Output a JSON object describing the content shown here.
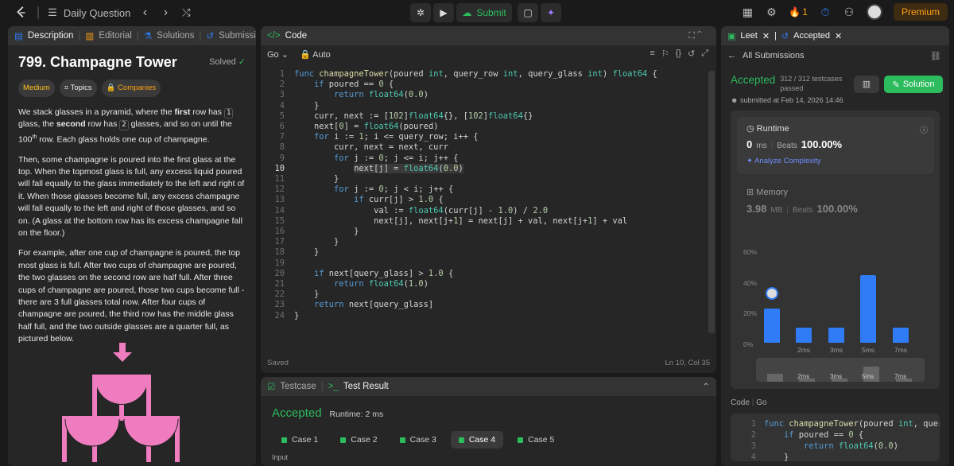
{
  "topbar": {
    "list_label": "Daily Question",
    "submit_label": "Submit",
    "streak": "1",
    "premium_label": "Premium"
  },
  "description": {
    "tabs": [
      "Description",
      "Editorial",
      "Solutions",
      "Submissions"
    ],
    "title": "799. Champagne Tower",
    "status": "Solved",
    "chips": [
      "Medium",
      "Topics",
      "Companies"
    ],
    "p1_a": "We stack glasses in a pyramid, where the ",
    "p1_first": "first",
    "p1_b": " row has ",
    "p1_k1": "1",
    "p1_c": " glass, the ",
    "p1_second": "second",
    "p1_d": " row has ",
    "p1_k2": "2",
    "p1_e": " glasses, and so on until the 100",
    "p1_th": "th",
    "p1_f": " row.  Each glass holds one cup of champagne.",
    "p2": "Then, some champagne is poured into the first glass at the top.  When the topmost glass is full, any excess liquid poured will fall equally to the glass immediately to the left and right of it.  When those glasses become full, any excess champagne will fall equally to the left and right of those glasses, and so on.  (A glass at the bottom row has its excess champagne fall on the floor.)",
    "p3": "For example, after one cup of champagne is poured, the top most glass is full.  After two cups of champagne are poured, the two glasses on the second row are half full.  After three cups of champagne are poured, those two cups become full - there are 3 full glasses total now.  After four cups of champagne are poured, the third row has the middle glass half full, and the two outside glasses are a quarter full, as pictured below."
  },
  "code": {
    "tab": "Code",
    "language": "Go",
    "mode": "Auto",
    "status_left": "Saved",
    "status_right": "Ln 10, Col 35",
    "lines": [
      "func champagneTower(poured int, query_row int, query_glass int) float64 {",
      "    if poured == 0 {",
      "        return float64(0.0)",
      "    }",
      "    curr, next := [102]float64{}, [102]float64{}",
      "    next[0] = float64(poured)",
      "    for i := 1; i <= query_row; i++ {",
      "        curr, next = next, curr",
      "        for j := 0; j <= i; j++ {",
      "            next[j] = float64(0.0)",
      "        }",
      "        for j := 0; j < i; j++ {",
      "            if curr[j] > 1.0 {",
      "                val := float64(curr[j] - 1.0) / 2.0",
      "                next[j], next[j+1] = next[j] + val, next[j+1] + val",
      "            }",
      "        }",
      "    }",
      "",
      "    if next[query_glass] > 1.0 {",
      "        return float64(1.0)",
      "    }",
      "    return next[query_glass]",
      "}"
    ]
  },
  "test": {
    "tabs": [
      "Testcase",
      "Test Result"
    ],
    "result": "Accepted",
    "runtime": "Runtime: 2 ms",
    "cases": [
      "Case 1",
      "Case 2",
      "Case 3",
      "Case 4",
      "Case 5"
    ],
    "active_case": 3,
    "input_label": "Input"
  },
  "submission": {
    "tabs": [
      "Leet",
      "Accepted"
    ],
    "all_label": "All Submissions",
    "status": "Accepted",
    "testcases": "312 / 312 testcases passed",
    "solution_label": "Solution",
    "submitted": "submitted at Feb 14, 2026 14:46",
    "runtime_title": "Runtime",
    "runtime_value": "0",
    "runtime_unit": "ms",
    "beats_label": "Beats",
    "runtime_beats": "100.00%",
    "analyze": "Analyze Complexity",
    "memory_title": "Memory",
    "memory_value": "3.98",
    "memory_unit": "MB",
    "memory_beats": "100.00%",
    "code_label": "Code",
    "code_lang": "Go",
    "code_lines": [
      "func champagneTower(poured int, query_",
      "    if poured == 0 {",
      "        return float64(0.0)",
      "    }"
    ]
  },
  "chart_data": {
    "type": "bar",
    "y_ticks": [
      "60%",
      "40%",
      "20%",
      "0%"
    ],
    "ylim": [
      0,
      60
    ],
    "categories": [
      "",
      "2ms",
      "3ms",
      "5ms",
      "7ms"
    ],
    "values": [
      22,
      10,
      10,
      44,
      10
    ],
    "colors": {
      "bar": "#2f7cf6",
      "accent": "#2cbb5d"
    }
  }
}
